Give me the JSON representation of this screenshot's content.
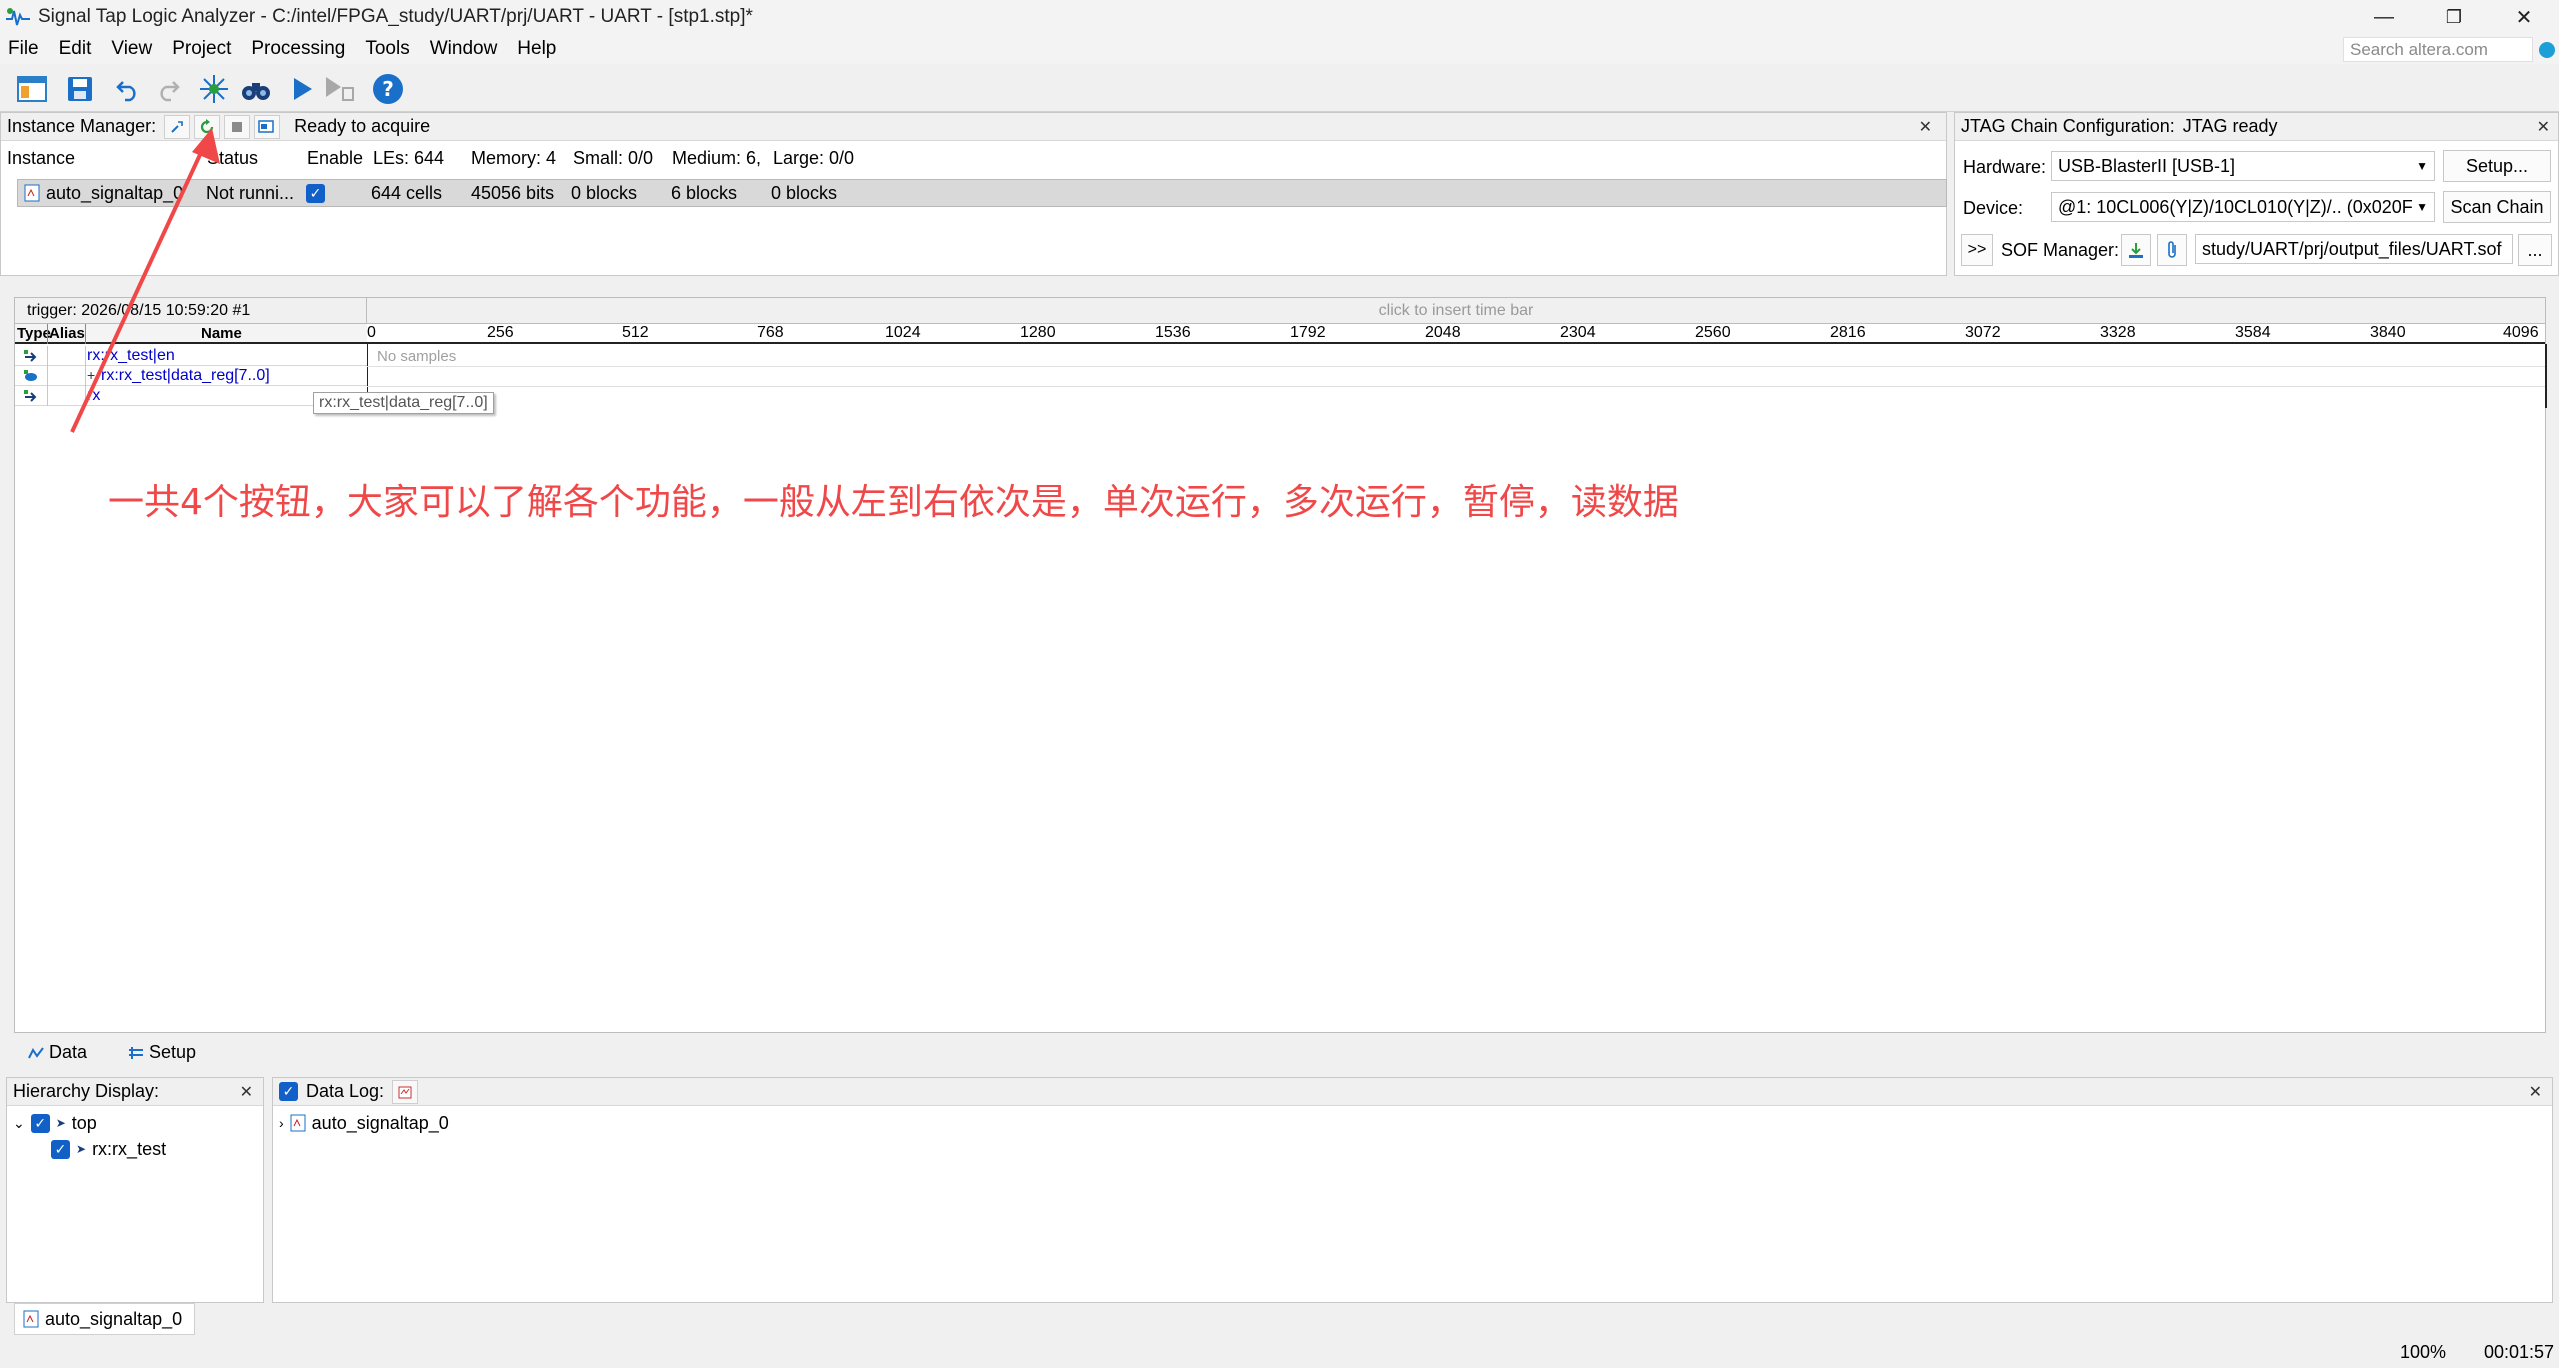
{
  "window": {
    "title": "Signal Tap Logic Analyzer - C:/intel/FPGA_study/UART/prj/UART - UART - [stp1.stp]*",
    "minimize": "—",
    "maximize": "❐",
    "close": "✕"
  },
  "menu": {
    "items": [
      {
        "label": "File"
      },
      {
        "label": "Edit"
      },
      {
        "label": "View"
      },
      {
        "label": "Project"
      },
      {
        "label": "Processing"
      },
      {
        "label": "Tools"
      },
      {
        "label": "Window"
      },
      {
        "label": "Help"
      }
    ],
    "search_placeholder": "Search altera.com"
  },
  "instance_manager": {
    "label": "Instance Manager:",
    "status": "Ready to acquire",
    "columns": {
      "instance": "Instance",
      "status": "Status",
      "enable": "Enable",
      "les": "LEs: 644",
      "memory": "Memory: 4",
      "small": "Small: 0/0",
      "medium": "Medium: 6,",
      "large": "Large: 0/0"
    },
    "row": {
      "instance": "auto_signaltap_0",
      "status": "Not runni...",
      "les": "644 cells",
      "memory": "45056 bits",
      "small": "0 blocks",
      "medium": "6 blocks",
      "large": "0 blocks"
    }
  },
  "jtag": {
    "label": "JTAG Chain Configuration:",
    "status": "JTAG ready",
    "hardware_label": "Hardware:",
    "hardware_value": "USB-BlasterII [USB-1]",
    "setup_button": "Setup...",
    "device_label": "Device:",
    "device_value": "@1: 10CL006(Y|Z)/10CL010(Y|Z)/.. (0x020F",
    "scan_button": "Scan Chain",
    "expand_button": ">>",
    "sof_label": "SOF Manager:",
    "sof_path": "study/UART/prj/output_files/UART.sof",
    "browse_button": "..."
  },
  "waveform": {
    "trigger": "trigger: 2026/08/15 10:59:20  #1",
    "time_bar_hint": "click to insert time bar",
    "col_type": "Type",
    "col_alias": "Alias",
    "col_name": "Name",
    "ticks": [
      "0",
      "256",
      "512",
      "768",
      "1024",
      "1280",
      "1536",
      "1792",
      "2048",
      "2304",
      "2560",
      "2816",
      "3072",
      "3328",
      "3584",
      "3840",
      "4096"
    ],
    "no_samples": "No samples",
    "signals": [
      {
        "name": "rx:rx_test|en"
      },
      {
        "name": "rx:rx_test|data_reg[7..0]",
        "expander": "+"
      },
      {
        "name": "rx"
      }
    ],
    "tooltip": "rx:rx_test|data_reg[7..0]"
  },
  "annotation": "一共4个按钮，大家可以了解各个功能，一般从左到右依次是，单次运行，多次运行，暂停，读数据",
  "tabs": {
    "data": "Data",
    "setup": "Setup"
  },
  "hierarchy": {
    "label": "Hierarchy Display:",
    "root": "top",
    "child": "rx:rx_test"
  },
  "data_log": {
    "label": "Data Log:",
    "item": "auto_signaltap_0"
  },
  "status_bar": {
    "instance_tab": "auto_signaltap_0",
    "zoom": "100%",
    "elapsed": "00:01:57"
  },
  "colors": {
    "annotation_red": "#f04848",
    "signal_blue": "#0000c8",
    "accent_blue": "#1060c8"
  }
}
